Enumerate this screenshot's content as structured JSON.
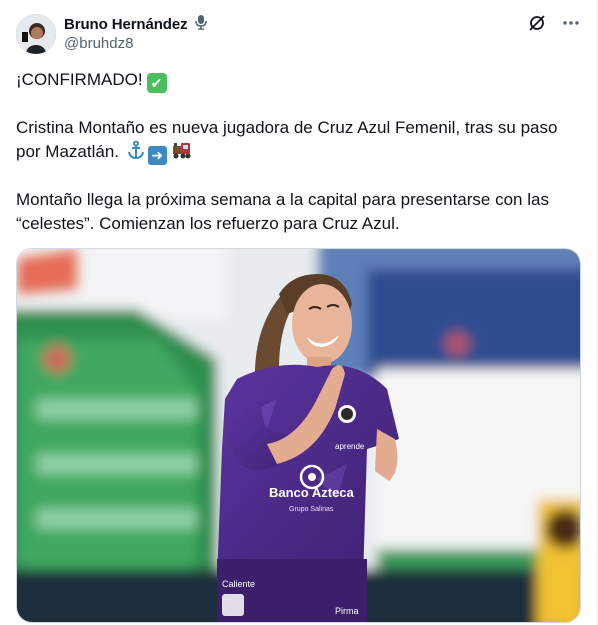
{
  "author": {
    "name": "Bruno Hernández",
    "handle": "@bruhdz8"
  },
  "icons": {
    "verified_badge": "microphone-icon",
    "grok": "grok-icon",
    "more": "more-icon"
  },
  "tweet": {
    "line1": "¡CONFIRMADO!",
    "line2a": "Cristina Montaño es nueva jugadora de Cruz Azul Femenil, tras su paso",
    "line2b": "por Mazatlán.",
    "line3a": "Montaño llega la próxima semana a la capital para presentarse con las",
    "line3b": "“celestes”. Comienzan los refuerzo para Cruz Azul."
  },
  "photo": {
    "sponsor": "Banco Azteca",
    "sponsor_sub": "Grupo Salinas",
    "jersey_top": "aprende",
    "shorts_text": "Caliente",
    "shorts_text2": "Pirma"
  },
  "colors": {
    "text": "#0f1419",
    "secondary": "#536471",
    "jersey": "#4b2b86",
    "check": "#4bbf5c",
    "arrow": "#3b88c3"
  }
}
